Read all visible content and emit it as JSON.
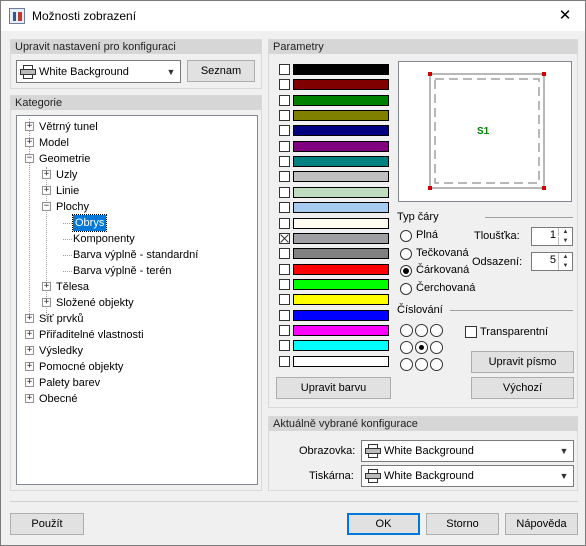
{
  "window": {
    "title": "Možnosti zobrazení",
    "close_glyph": "✕"
  },
  "config_group": {
    "heading": "Upravit nastavení pro konfiguraci",
    "combo_value": "White Background",
    "list_button": "Seznam"
  },
  "category_group": {
    "heading": "Kategorie",
    "tree": [
      {
        "label": "Větrný tunel",
        "expander": "+"
      },
      {
        "label": "Model",
        "expander": "+"
      },
      {
        "label": "Geometrie",
        "expander": "−"
      },
      {
        "label": "Uzly",
        "expander": "+"
      },
      {
        "label": "Linie",
        "expander": "+"
      },
      {
        "label": "Plochy",
        "expander": "−"
      },
      {
        "label": "Obrys",
        "expander": ""
      },
      {
        "label": "Komponenty",
        "expander": ""
      },
      {
        "label": "Barva výplně - standardní",
        "expander": ""
      },
      {
        "label": "Barva výplně - terén",
        "expander": ""
      },
      {
        "label": "Tělesa",
        "expander": "+"
      },
      {
        "label": "Složené objekty",
        "expander": "+"
      },
      {
        "label": "Síť prvků",
        "expander": "+"
      },
      {
        "label": "Přiřaditelné vlastnosti",
        "expander": "+"
      },
      {
        "label": "Výsledky",
        "expander": "+"
      },
      {
        "label": "Pomocné objekty",
        "expander": "+"
      },
      {
        "label": "Palety barev",
        "expander": "+"
      },
      {
        "label": "Obecné",
        "expander": "+"
      }
    ],
    "selected": "Obrys"
  },
  "params_group": {
    "heading": "Parametry",
    "colors": [
      "#000000",
      "#800000",
      "#008000",
      "#808000",
      "#000080",
      "#800080",
      "#008080",
      "#c0c0c0",
      "#c0dcc0",
      "#a6caf0",
      "#fffbf0",
      "#a0a0a4",
      "#808080",
      "#ff0000",
      "#00ff00",
      "#ffff00",
      "#0000ff",
      "#ff00ff",
      "#00ffff",
      "#ffffff"
    ],
    "checked_color_index": 11,
    "edit_color_button": "Upravit barvu",
    "preview_label": "S1",
    "preview_label_color": "#008000",
    "line_type_heading": "Typ čáry",
    "line_types": [
      "Plná",
      "Tečkovaná",
      "Čárkovaná",
      "Čerchovaná"
    ],
    "line_type_selected": 2,
    "thickness_label": "Tloušťka:",
    "thickness_value": "1",
    "offset_label": "Odsazení:",
    "offset_value": "5",
    "numbering_heading": "Číslování",
    "numbering_selected": 4,
    "transparent_label": "Transparentní",
    "transparent_checked": false,
    "edit_font_button": "Upravit písmo",
    "default_button": "Výchozí"
  },
  "current_group": {
    "heading": "Aktuálně vybrané konfigurace",
    "screen_label": "Obrazovka:",
    "screen_value": "White Background",
    "printer_label": "Tiskárna:",
    "printer_value": "White Background"
  },
  "footer": {
    "apply": "Použít",
    "ok": "OK",
    "cancel": "Storno",
    "help": "Nápověda"
  }
}
